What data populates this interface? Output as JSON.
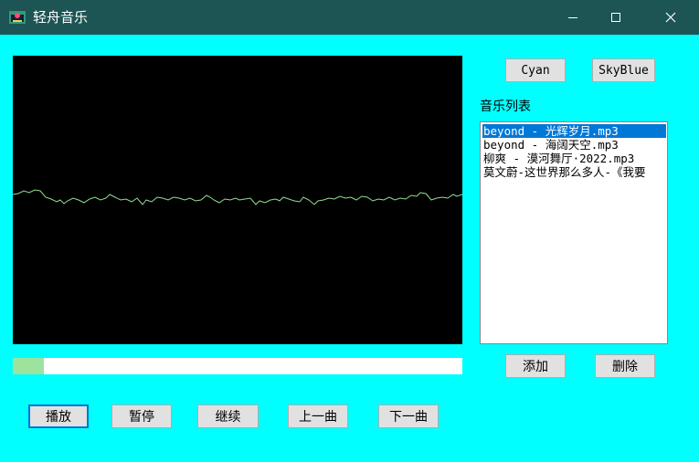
{
  "window": {
    "title": "轻舟音乐",
    "buttons": {
      "minimize": "minimize-icon",
      "maximize": "maximize-icon",
      "close": "close-icon"
    }
  },
  "theme_buttons": {
    "cyan_label": "Cyan",
    "skyblue_label": "SkyBlue"
  },
  "playlist": {
    "label": "音乐列表",
    "items": [
      {
        "label": "beyond - 光辉岁月.mp3",
        "selected": true
      },
      {
        "label": "beyond - 海阔天空.mp3",
        "selected": false
      },
      {
        "label": "柳爽 - 漠河舞厅·2022.mp3",
        "selected": false
      },
      {
        "label": "莫文蔚-这世界那么多人-《我要",
        "selected": false
      }
    ],
    "add_label": "添加",
    "delete_label": "删除"
  },
  "playback": {
    "progress": 0.07,
    "play_label": "播放",
    "pause_label": "暂停",
    "resume_label": "继续",
    "prev_label": "上一曲",
    "next_label": "下一曲"
  },
  "colors": {
    "background": "#00ffff",
    "titlebar": "#1d5454",
    "scope_bg": "#000000",
    "waveform": "#8fe08f",
    "progress_fill": "#9de39d",
    "selection": "#0078d7"
  }
}
